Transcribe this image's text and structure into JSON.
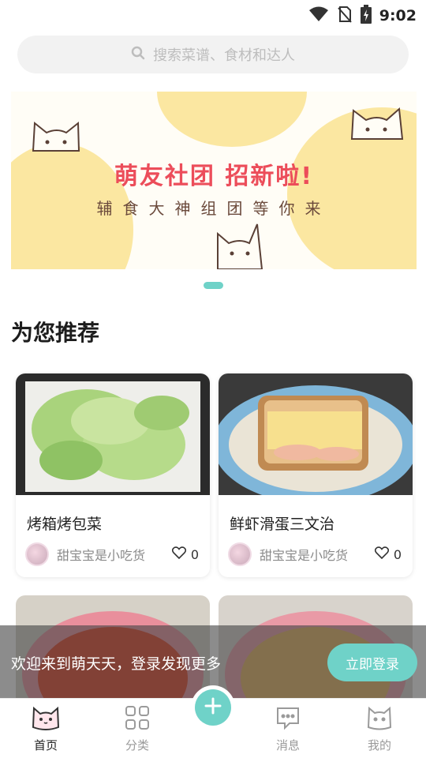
{
  "status_bar": {
    "time": "9:02",
    "icons": [
      "wifi-icon",
      "no-sim-icon",
      "battery-charging-icon"
    ]
  },
  "search": {
    "placeholder": "搜索菜谱、食材和达人",
    "icon": "search-icon"
  },
  "banner": {
    "title": "萌友社团 招新啦!",
    "subtitle": "辅食大神组团等你来",
    "page_count": 1,
    "active_page": 1
  },
  "recommend": {
    "title": "为您推荐",
    "cards": [
      {
        "title": "烤箱烤包菜",
        "author": "甜宝宝是小吃货",
        "likes": "0"
      },
      {
        "title": "鲜虾滑蛋三文治",
        "author": "甜宝宝是小吃货",
        "likes": "0"
      }
    ]
  },
  "login_prompt": {
    "text": "欢迎来到萌天天，登录发现更多",
    "button": "立即登录"
  },
  "tab_bar": {
    "tabs": [
      {
        "label": "首页",
        "icon": "cat-face-icon",
        "active": true
      },
      {
        "label": "分类",
        "icon": "grid-icon",
        "active": false
      },
      {
        "label": "消息",
        "icon": "message-icon",
        "active": false
      },
      {
        "label": "我的",
        "icon": "profile-icon",
        "active": false
      }
    ],
    "add_icon": "plus-icon"
  },
  "colors": {
    "accent": "#6fd2c8",
    "banner_title": "#ec4d5a",
    "banner_yellow": "#fbe7a1"
  }
}
